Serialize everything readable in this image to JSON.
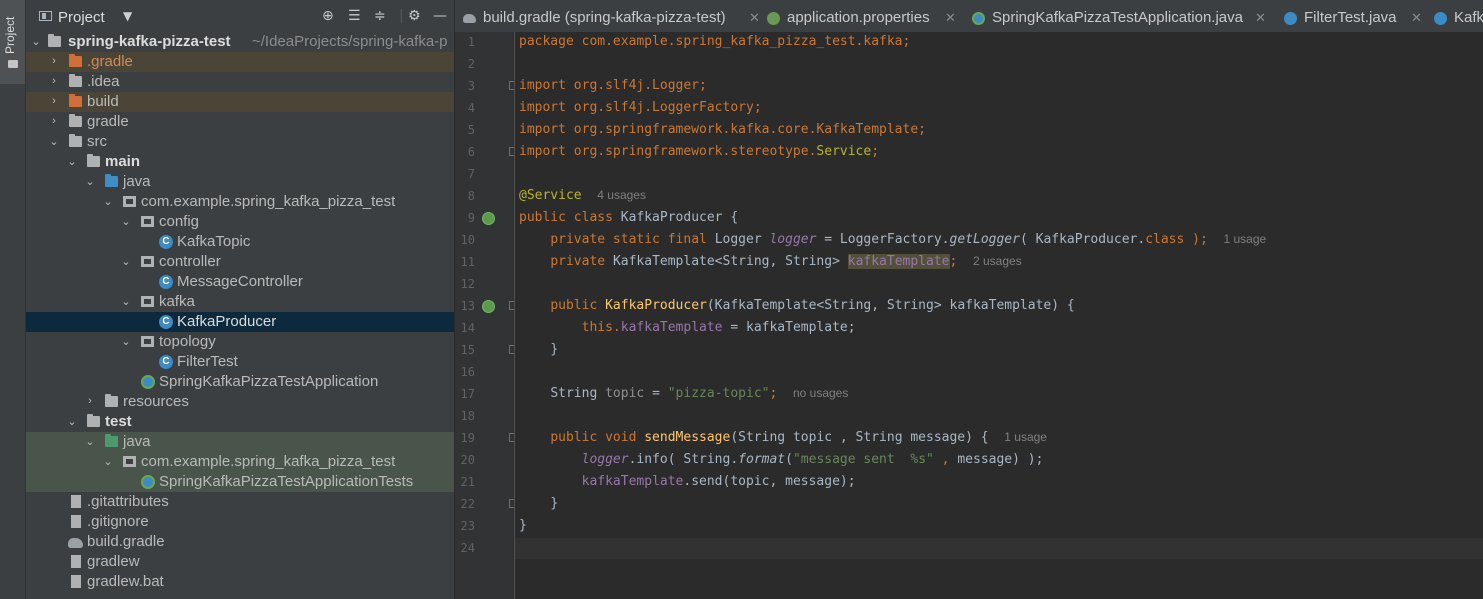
{
  "sidebar_strip": {
    "project_tab_label": "Project"
  },
  "project_panel": {
    "title": "Project",
    "tree": [
      {
        "label": "spring-kafka-pizza-test",
        "path": "~/IdeaProjects/spring-kafka-p"
      },
      {
        "label": ".gradle"
      },
      {
        "label": ".idea"
      },
      {
        "label": "build"
      },
      {
        "label": "gradle"
      },
      {
        "label": "src"
      },
      {
        "label": "main"
      },
      {
        "label": "java"
      },
      {
        "label": "com.example.spring_kafka_pizza_test"
      },
      {
        "label": "config"
      },
      {
        "label": "KafkaTopic"
      },
      {
        "label": "controller"
      },
      {
        "label": "MessageController"
      },
      {
        "label": "kafka"
      },
      {
        "label": "KafkaProducer"
      },
      {
        "label": "topology"
      },
      {
        "label": "FilterTest"
      },
      {
        "label": "SpringKafkaPizzaTestApplication"
      },
      {
        "label": "resources"
      },
      {
        "label": "test"
      },
      {
        "label": "java"
      },
      {
        "label": "com.example.spring_kafka_pizza_test"
      },
      {
        "label": "SpringKafkaPizzaTestApplicationTests"
      },
      {
        "label": ".gitattributes"
      },
      {
        "label": ".gitignore"
      },
      {
        "label": "build.gradle"
      },
      {
        "label": "gradlew"
      },
      {
        "label": "gradlew.bat"
      }
    ]
  },
  "editor": {
    "tabs": [
      {
        "label": "build.gradle (spring-kafka-pizza-test)",
        "icon": "gradle-icon"
      },
      {
        "label": "application.properties",
        "icon": "properties-icon"
      },
      {
        "label": "SpringKafkaPizzaTestApplication.java",
        "icon": "spring-class-icon"
      },
      {
        "label": "FilterTest.java",
        "icon": "class-icon"
      },
      {
        "label": "Kafk",
        "icon": "class-icon"
      }
    ],
    "line_numbers": [
      "1",
      "2",
      "3",
      "4",
      "5",
      "6",
      "7",
      "8",
      "9",
      "10",
      "11",
      "12",
      "13",
      "14",
      "15",
      "16",
      "17",
      "18",
      "19",
      "20",
      "21",
      "22",
      "23",
      "24"
    ],
    "hints": {
      "service_usages": "4 usages",
      "logger_usage": "1 usage",
      "template_usages": "2 usages",
      "topic_usages": "no usages",
      "send_usage": "1 usage"
    },
    "code": {
      "l1": "package com.example.spring_kafka_pizza_test.kafka;",
      "l3_a": "import org.slf4j.Logger",
      "semi": ";",
      "l4_a": "import org.slf4j.LoggerFactory",
      "l5_a": "import org.springframework.kafka.core.KafkaTemplate",
      "l6_a": "import org.springframework.stereotype.",
      "l6_b": "Service",
      "l8": "@Service",
      "l9_kw": "public class ",
      "l9_name": "KafkaProducer {",
      "l10_kw": "private static final ",
      "l10_type": "Logger ",
      "l10_f": "logger",
      "l10_eq": " = LoggerFactory.",
      "l10_m": "getLogger",
      "l10_args": "( KafkaProducer.",
      "l10_cls": "class",
      "l10_end": " );",
      "l11_kw": "private ",
      "l11_type": "KafkaTemplate<String, String> ",
      "l11_f": "kafkaTemplate",
      "l13_kw": "public ",
      "l13_m": "KafkaProducer",
      "l13_args": "(KafkaTemplate<String, String> kafkaTemplate) {",
      "l14_kw": "this.",
      "l14_f": "kafkaTemplate",
      "l14_rest": " = kafkaTemplate;",
      "l15": "}",
      "l17_type": "String ",
      "l17_f": "topic",
      "l17_eq": " = ",
      "l17_s": "\"pizza-topic\"",
      "l19_kw": "public void ",
      "l19_m": "sendMessage",
      "l19_args": "(String topic , String message) {",
      "l20_f": "logger",
      "l20_a": ".info( String.",
      "l20_m": "format",
      "l20_s": "\"message sent  %s\"",
      "l20_c": " , ",
      "l20_end": "message) );",
      "l21_f": "kafkaTemplate",
      "l21_rest": ".send(topic, message);",
      "l22": "}",
      "l23": "}"
    }
  }
}
